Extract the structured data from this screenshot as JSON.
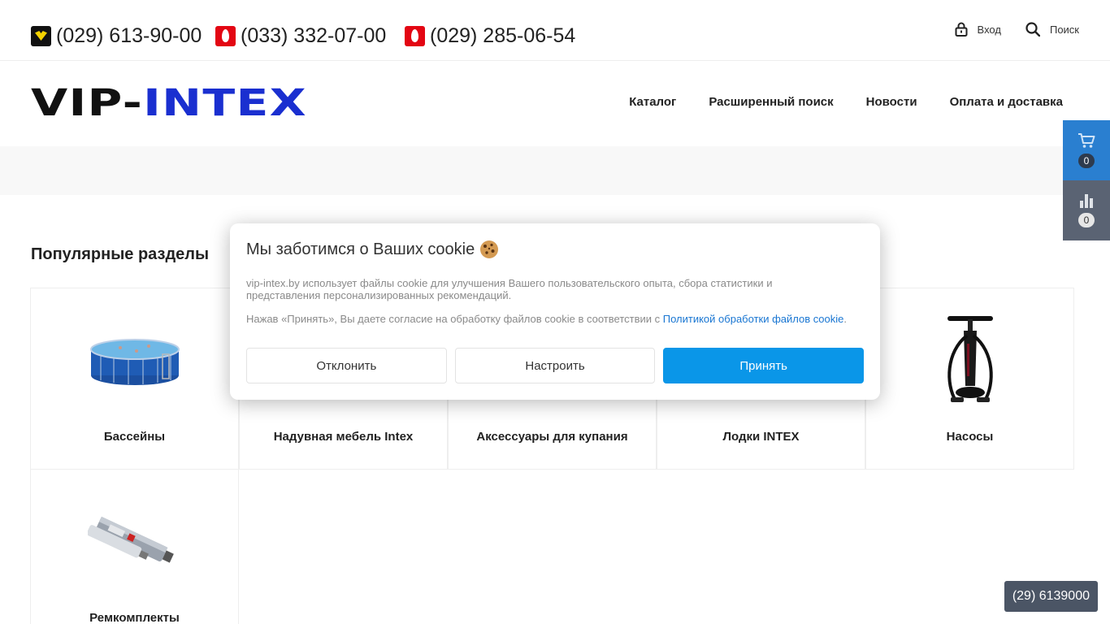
{
  "phones": [
    {
      "operator_icon": "velcom-icon",
      "number": "(029) 613-90-00"
    },
    {
      "operator_icon": "mts-icon",
      "number": "(033) 332-07-00"
    },
    {
      "operator_icon": "mts-icon",
      "number": "(029) 285-06-54"
    }
  ],
  "user_links": {
    "login_label": "Вход",
    "search_label": "Поиск"
  },
  "logo": {
    "text": "VIP-INTEX",
    "colors": {
      "vip": "#111111",
      "intex": "#1a2fd0"
    }
  },
  "nav": [
    {
      "label": "Каталог"
    },
    {
      "label": "Расширенный поиск"
    },
    {
      "label": "Новости"
    },
    {
      "label": "Оплата и доставка"
    }
  ],
  "side": {
    "cart_count": "0",
    "compare_count": "0"
  },
  "popular": {
    "title": "Популярные разделы",
    "items": [
      {
        "label": "Бассейны",
        "image": "pool-image"
      },
      {
        "label": "Надувная мебель Intex",
        "image": "inflatable-furniture-image"
      },
      {
        "label": "Аксессуары для купания",
        "image": "swim-accessories-image"
      },
      {
        "label": "Лодки INTEX",
        "image": "boats-image"
      },
      {
        "label": "Насосы",
        "image": "pump-image"
      },
      {
        "label": "Ремкомплекты",
        "image": "repair-kit-image"
      }
    ]
  },
  "cookie": {
    "title": "Мы заботимся о Ваших cookie",
    "text1": "vip-intex.by использует файлы cookie для улучшения Вашего пользовательского опыта, сбора статистики и представления персонализированных рекомендаций.",
    "text2_prefix": "Нажав «Принять», Вы даете согласие на обработку файлов cookie в соответствии с ",
    "text2_link": "Политикой обработки файлов cookie",
    "text2_suffix": ".",
    "decline_label": "Отклонить",
    "configure_label": "Настроить",
    "accept_label": "Принять"
  },
  "callback_phone": "(29) 6139000",
  "colors": {
    "accent_blue": "#0a96e8",
    "cart_blue": "#2a7fd0",
    "compare_gray": "#5a6373"
  }
}
